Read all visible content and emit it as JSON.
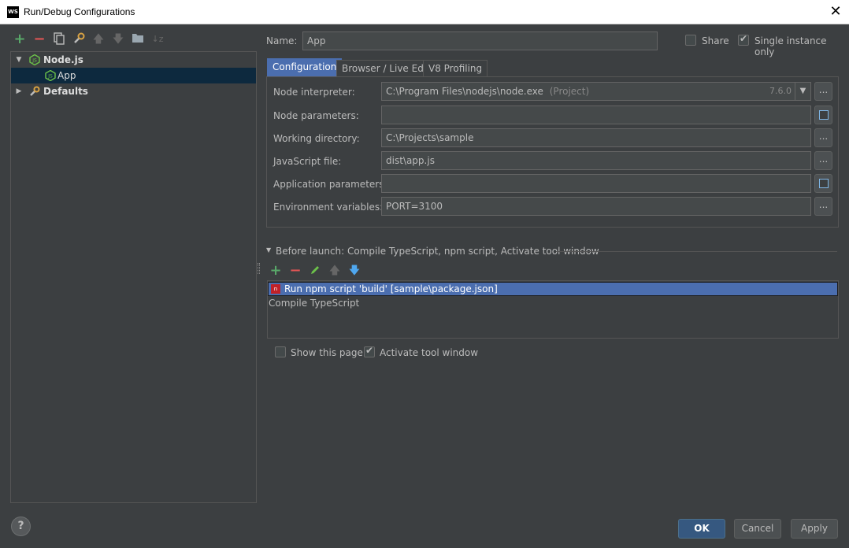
{
  "window": {
    "app_logo": "WS",
    "title": "Run/Debug Configurations",
    "close": "✕"
  },
  "toolbar": {
    "icons": [
      "plus-icon",
      "minus-icon",
      "copy-icon",
      "wrench-icon",
      "arrow-up-icon",
      "arrow-down-icon",
      "folder-icon",
      "sort-icon"
    ]
  },
  "tree": {
    "items": [
      {
        "label": "Node.js",
        "expanded": true
      },
      {
        "label": "App",
        "selected": true
      },
      {
        "label": "Defaults",
        "expanded": false
      }
    ]
  },
  "form": {
    "name_label": "Name:",
    "name_value": "App",
    "share_label": "Share",
    "share_checked": false,
    "single_instance_label": "Single instance only",
    "single_instance_checked": true
  },
  "tabs": [
    {
      "label": "Configuration",
      "active": true
    },
    {
      "label": "Browser / Live Edit",
      "active": false
    },
    {
      "label": "V8 Profiling",
      "active": false
    }
  ],
  "config": {
    "node_interpreter_label": "Node interpreter:",
    "node_interpreter_value": "C:\\Program Files\\nodejs\\node.exe",
    "node_interpreter_hint": "(Project)",
    "node_version": "7.6.0",
    "node_parameters_label": "Node parameters:",
    "node_parameters_value": "",
    "working_directory_label": "Working directory:",
    "working_directory_value": "C:\\Projects\\sample",
    "js_file_label": "JavaScript file:",
    "js_file_value": "dist\\app.js",
    "app_parameters_label": "Application parameters:",
    "app_parameters_value": "",
    "env_vars_label": "Environment variables:",
    "env_vars_value": "PORT=3100",
    "dots": "..."
  },
  "before_launch": {
    "title": "Before launch: Compile TypeScript, npm script, Activate tool window",
    "icons": [
      "plus-icon",
      "minus-icon",
      "pencil-icon",
      "arrow-up-icon",
      "arrow-down-icon"
    ],
    "items": [
      {
        "label": "Run npm script 'build' [sample\\package.json]",
        "selected": true
      },
      {
        "label": "Compile TypeScript",
        "selected": false
      }
    ]
  },
  "options": {
    "show_page_label": "Show this page",
    "show_page_checked": false,
    "activate_tool_label": "Activate tool window",
    "activate_tool_checked": true
  },
  "buttons": {
    "ok": "OK",
    "cancel": "Cancel",
    "apply": "Apply",
    "help": "?"
  },
  "colors": {
    "background": "#3c3f41",
    "accent": "#4b6eaf",
    "selected_tree": "#0d293e",
    "add_green": "#59a869",
    "remove_red": "#e05555",
    "nodejs_green": "#6cc24a"
  }
}
